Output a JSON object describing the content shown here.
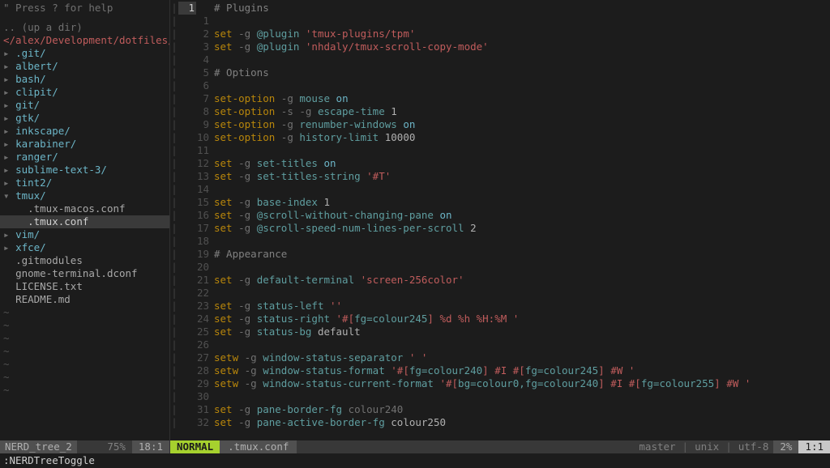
{
  "sidebar": {
    "hint": "\" Press ? for help",
    "updir": ".. (up a dir)",
    "path": "</alex/Development/dotfiles/",
    "nodes": [
      {
        "type": "dir-closed",
        "depth": 0,
        "name": ".git/"
      },
      {
        "type": "dir-closed",
        "depth": 0,
        "name": "albert/"
      },
      {
        "type": "dir-closed",
        "depth": 0,
        "name": "bash/"
      },
      {
        "type": "dir-closed",
        "depth": 0,
        "name": "clipit/"
      },
      {
        "type": "dir-closed",
        "depth": 0,
        "name": "git/"
      },
      {
        "type": "dir-closed",
        "depth": 0,
        "name": "gtk/"
      },
      {
        "type": "dir-closed",
        "depth": 0,
        "name": "inkscape/"
      },
      {
        "type": "dir-closed",
        "depth": 0,
        "name": "karabiner/"
      },
      {
        "type": "dir-closed",
        "depth": 0,
        "name": "ranger/"
      },
      {
        "type": "dir-closed",
        "depth": 0,
        "name": "sublime-text-3/"
      },
      {
        "type": "dir-closed",
        "depth": 0,
        "name": "tint2/"
      },
      {
        "type": "dir-open",
        "depth": 0,
        "name": "tmux/"
      },
      {
        "type": "file",
        "depth": 1,
        "name": ".tmux-macos.conf"
      },
      {
        "type": "file",
        "depth": 1,
        "name": ".tmux.conf",
        "selected": true
      },
      {
        "type": "dir-closed",
        "depth": 0,
        "name": "vim/"
      },
      {
        "type": "dir-closed",
        "depth": 0,
        "name": "xfce/"
      },
      {
        "type": "file",
        "depth": 0,
        "name": ".gitmodules"
      },
      {
        "type": "file",
        "depth": 0,
        "name": "gnome-terminal.dconf"
      },
      {
        "type": "file",
        "depth": 0,
        "name": "LICENSE.txt"
      },
      {
        "type": "file",
        "depth": 0,
        "name": "README.md"
      }
    ],
    "tilde_rows": 7,
    "status": {
      "name": "NERD_tree_2",
      "percent": "75%",
      "pos": "18:1"
    }
  },
  "buffer": {
    "lines": [
      {
        "abs": "1",
        "rel": "",
        "tokens": [
          [
            "cmt",
            "# Plugins"
          ]
        ]
      },
      {
        "abs": "",
        "rel": "1",
        "tokens": []
      },
      {
        "abs": "",
        "rel": "2",
        "tokens": [
          [
            "kw",
            "set"
          ],
          [
            "dim",
            " -g "
          ],
          [
            "opt",
            "@plugin"
          ],
          [
            "dim",
            " "
          ],
          [
            "str",
            "'tmux-plugins/tpm'"
          ]
        ]
      },
      {
        "abs": "",
        "rel": "3",
        "tokens": [
          [
            "kw",
            "set"
          ],
          [
            "dim",
            " -g "
          ],
          [
            "opt",
            "@plugin"
          ],
          [
            "dim",
            " "
          ],
          [
            "str",
            "'nhdaly/tmux-scroll-copy-mode'"
          ]
        ]
      },
      {
        "abs": "",
        "rel": "4",
        "tokens": []
      },
      {
        "abs": "",
        "rel": "5",
        "tokens": [
          [
            "cmt",
            "# Options"
          ]
        ]
      },
      {
        "abs": "",
        "rel": "6",
        "tokens": []
      },
      {
        "abs": "",
        "rel": "7",
        "tokens": [
          [
            "kw",
            "set-option"
          ],
          [
            "dim",
            " -g "
          ],
          [
            "opt",
            "mouse"
          ],
          [
            "dim",
            " "
          ],
          [
            "const",
            "on"
          ]
        ]
      },
      {
        "abs": "",
        "rel": "8",
        "tokens": [
          [
            "kw",
            "set-option"
          ],
          [
            "dim",
            " -s -g "
          ],
          [
            "opt",
            "escape-time"
          ],
          [
            "dim",
            " "
          ],
          [
            "num",
            "1"
          ]
        ]
      },
      {
        "abs": "",
        "rel": "9",
        "tokens": [
          [
            "kw",
            "set-option"
          ],
          [
            "dim",
            " -g "
          ],
          [
            "opt",
            "renumber-windows"
          ],
          [
            "dim",
            " "
          ],
          [
            "const",
            "on"
          ]
        ]
      },
      {
        "abs": "",
        "rel": "10",
        "tokens": [
          [
            "kw",
            "set-option"
          ],
          [
            "dim",
            " -g "
          ],
          [
            "opt",
            "history-limit"
          ],
          [
            "dim",
            " "
          ],
          [
            "num",
            "10000"
          ]
        ]
      },
      {
        "abs": "",
        "rel": "11",
        "tokens": []
      },
      {
        "abs": "",
        "rel": "12",
        "tokens": [
          [
            "kw",
            "set"
          ],
          [
            "dim",
            " -g "
          ],
          [
            "opt",
            "set-titles"
          ],
          [
            "dim",
            " "
          ],
          [
            "const",
            "on"
          ]
        ]
      },
      {
        "abs": "",
        "rel": "13",
        "tokens": [
          [
            "kw",
            "set"
          ],
          [
            "dim",
            " -g "
          ],
          [
            "opt",
            "set-titles-string"
          ],
          [
            "dim",
            " "
          ],
          [
            "str",
            "'#T'"
          ]
        ]
      },
      {
        "abs": "",
        "rel": "14",
        "tokens": []
      },
      {
        "abs": "",
        "rel": "15",
        "tokens": [
          [
            "kw",
            "set"
          ],
          [
            "dim",
            " -g "
          ],
          [
            "opt",
            "base-index"
          ],
          [
            "dim",
            " "
          ],
          [
            "num",
            "1"
          ]
        ]
      },
      {
        "abs": "",
        "rel": "16",
        "tokens": [
          [
            "kw",
            "set"
          ],
          [
            "dim",
            " -g "
          ],
          [
            "opt",
            "@scroll-without-changing-pane"
          ],
          [
            "dim",
            " "
          ],
          [
            "const",
            "on"
          ]
        ]
      },
      {
        "abs": "",
        "rel": "17",
        "tokens": [
          [
            "kw",
            "set"
          ],
          [
            "dim",
            " -g "
          ],
          [
            "opt",
            "@scroll-speed-num-lines-per-scroll"
          ],
          [
            "dim",
            " "
          ],
          [
            "num",
            "2"
          ]
        ]
      },
      {
        "abs": "",
        "rel": "18",
        "tokens": []
      },
      {
        "abs": "",
        "rel": "19",
        "tokens": [
          [
            "cmt",
            "# Appearance"
          ]
        ]
      },
      {
        "abs": "",
        "rel": "20",
        "tokens": []
      },
      {
        "abs": "",
        "rel": "21",
        "tokens": [
          [
            "kw",
            "set"
          ],
          [
            "dim",
            " -g "
          ],
          [
            "opt",
            "default-terminal"
          ],
          [
            "dim",
            " "
          ],
          [
            "str",
            "'screen-256color'"
          ]
        ]
      },
      {
        "abs": "",
        "rel": "22",
        "tokens": []
      },
      {
        "abs": "",
        "rel": "23",
        "tokens": [
          [
            "kw",
            "set"
          ],
          [
            "dim",
            " -g "
          ],
          [
            "opt",
            "status-left"
          ],
          [
            "dim",
            " "
          ],
          [
            "str",
            "''"
          ]
        ]
      },
      {
        "abs": "",
        "rel": "24",
        "tokens": [
          [
            "kw",
            "set"
          ],
          [
            "dim",
            " -g "
          ],
          [
            "opt",
            "status-right"
          ],
          [
            "dim",
            " "
          ],
          [
            "seg-red",
            "'#["
          ],
          [
            "seg-teal",
            "fg=colour245"
          ],
          [
            "seg-red",
            "] %d %h %H:%M '"
          ]
        ]
      },
      {
        "abs": "",
        "rel": "25",
        "tokens": [
          [
            "kw",
            "set"
          ],
          [
            "dim",
            " -g "
          ],
          [
            "opt",
            "status-bg"
          ],
          [
            "dim",
            " "
          ],
          [
            "num",
            "default"
          ]
        ]
      },
      {
        "abs": "",
        "rel": "26",
        "tokens": []
      },
      {
        "abs": "",
        "rel": "27",
        "tokens": [
          [
            "kw",
            "setw"
          ],
          [
            "dim",
            " -g "
          ],
          [
            "opt",
            "window-status-separator"
          ],
          [
            "dim",
            " "
          ],
          [
            "str",
            "' '"
          ]
        ]
      },
      {
        "abs": "",
        "rel": "28",
        "tokens": [
          [
            "kw",
            "setw"
          ],
          [
            "dim",
            " -g "
          ],
          [
            "opt",
            "window-status-format"
          ],
          [
            "dim",
            " "
          ],
          [
            "seg-red",
            "'#["
          ],
          [
            "seg-teal",
            "fg=colour240"
          ],
          [
            "seg-red",
            "] #I #["
          ],
          [
            "seg-teal",
            "fg=colour245"
          ],
          [
            "seg-red",
            "] #W '"
          ]
        ]
      },
      {
        "abs": "",
        "rel": "29",
        "tokens": [
          [
            "kw",
            "setw"
          ],
          [
            "dim",
            " -g "
          ],
          [
            "opt",
            "window-status-current-format"
          ],
          [
            "dim",
            " "
          ],
          [
            "seg-red",
            "'#["
          ],
          [
            "seg-teal",
            "bg=colour0,fg=colour240"
          ],
          [
            "seg-red",
            "] #I #["
          ],
          [
            "seg-teal",
            "fg=colour255"
          ],
          [
            "seg-red",
            "] #W '"
          ]
        ]
      },
      {
        "abs": "",
        "rel": "30",
        "tokens": []
      },
      {
        "abs": "",
        "rel": "31",
        "tokens": [
          [
            "kw",
            "set"
          ],
          [
            "dim",
            " -g "
          ],
          [
            "opt",
            "pane-border-fg"
          ],
          [
            "dim",
            " "
          ],
          [
            "dim",
            "colour240"
          ]
        ]
      },
      {
        "abs": "",
        "rel": "32",
        "tokens": [
          [
            "kw",
            "set"
          ],
          [
            "dim",
            " -g "
          ],
          [
            "opt",
            "pane-active-border-fg"
          ],
          [
            "dim",
            " "
          ],
          [
            "num",
            "colour250"
          ]
        ]
      }
    ]
  },
  "editor_status": {
    "mode": "NORMAL",
    "filename": ".tmux.conf",
    "branch": "master",
    "fileformat": "unix",
    "encoding": "utf-8",
    "percent": "2%",
    "pos": "1:1"
  },
  "cmdline": ":NERDTreeToggle"
}
